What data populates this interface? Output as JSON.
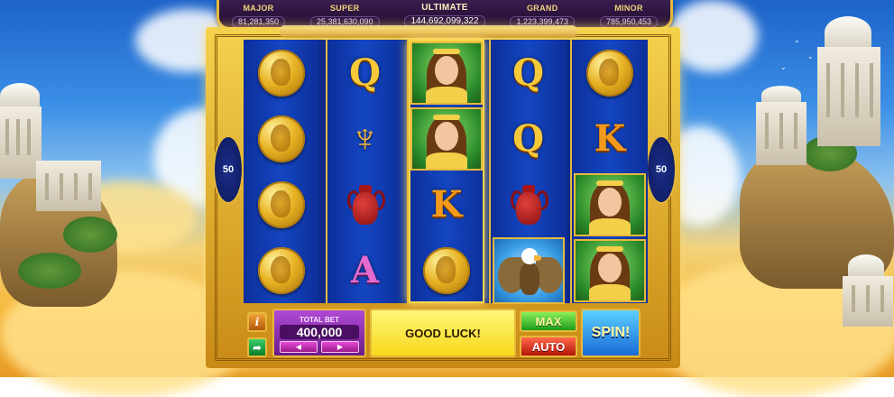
{
  "jackpots": [
    {
      "label": "MAJOR",
      "value": "81,281,350"
    },
    {
      "label": "SUPER",
      "value": "25,381,630,090"
    },
    {
      "label": "ULTIMATE",
      "value": "144,692,099,322"
    },
    {
      "label": "GRAND",
      "value": "1,223,399,473"
    },
    {
      "label": "MINOR",
      "value": "785,950,453"
    }
  ],
  "paylines": {
    "left": "50",
    "right": "50"
  },
  "reels": [
    [
      "coin",
      "coin",
      "coin",
      "coin"
    ],
    [
      "letter-q",
      "lyre",
      "vase",
      "letter-a"
    ],
    [
      "goddess",
      "goddess",
      "letter-k",
      "coin"
    ],
    [
      "letter-q",
      "letter-q",
      "vase",
      "eagle"
    ],
    [
      "coin",
      "letter-k",
      "goddess",
      "goddess"
    ]
  ],
  "symbol_text": {
    "letter-q": "Q",
    "letter-k": "K",
    "letter-a": "A"
  },
  "controls": {
    "info_label": "i",
    "total_bet_label": "TOTAL BET",
    "total_bet_value": "400,000",
    "message": "GOOD LUCK!",
    "max_label": "MAX",
    "auto_label": "AUTO",
    "spin_label": "SPIN!"
  }
}
